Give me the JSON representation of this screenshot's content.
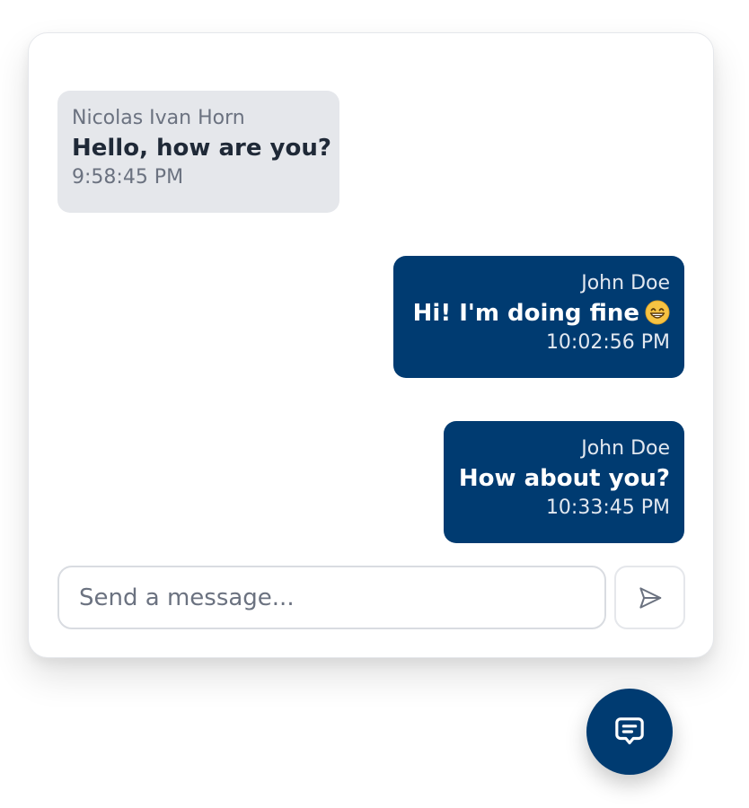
{
  "colors": {
    "primary": "#003b71",
    "received_bubble": "#e5e7eb",
    "muted_text": "#6b7280",
    "dark_text": "#1f2937"
  },
  "messages": [
    {
      "sender": "Nicolas Ivan Horn",
      "text": "Hello, how are you?",
      "time": "9:58:45 PM",
      "direction": "received"
    },
    {
      "sender": "John Doe",
      "text": "Hi! I'm doing fine",
      "emoji": "grinning-face-with-smiling-eyes",
      "time": "10:02:56 PM",
      "direction": "sent"
    },
    {
      "sender": "John Doe",
      "text": "How about you?",
      "time": "10:33:45 PM",
      "direction": "sent"
    }
  ],
  "composer": {
    "placeholder": "Send a message...",
    "value": "",
    "send_icon": "send-icon"
  },
  "launcher": {
    "icon": "chat-bubble-icon"
  }
}
